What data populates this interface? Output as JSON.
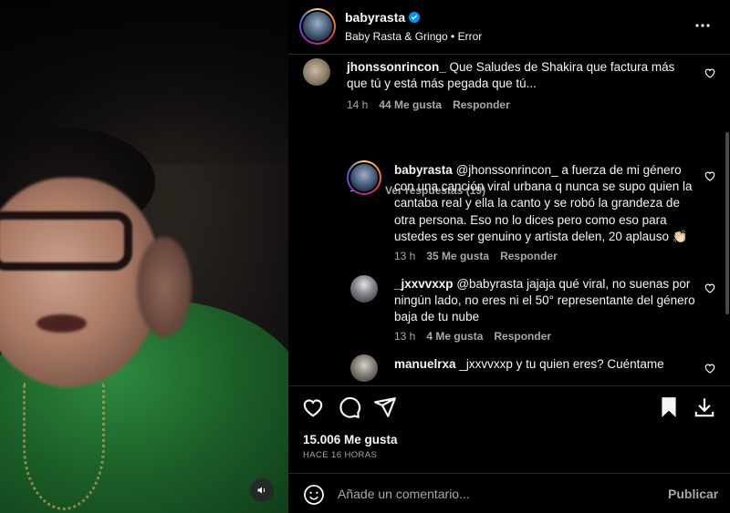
{
  "post": {
    "username": "babyrasta",
    "verified": true,
    "subtitle": "Baby Rasta & Gringo • Error",
    "more_icon": "more-horizontal-icon"
  },
  "comments": [
    {
      "username": "jhonssonrincon_",
      "text": "Que Saludes de Shakira que factura más que tú y está más pegada que tú...",
      "time": "14 h",
      "likes": "44 Me gusta",
      "reply": "Responder"
    }
  ],
  "view_replies": "Ver respuestas (19)",
  "replies": [
    {
      "username": "babyrasta",
      "text": "@jhonssonrincon_ a fuerza de mi género con una canción viral urbana q nunca se supo quien la cantaba real y ella la canto y se robó la grandeza de otra persona. Eso no lo dices pero como eso para ustedes es ser genuino y artista delen, 20 aplauso 👏🏻",
      "time": "13 h",
      "likes": "35 Me gusta",
      "reply": "Responder"
    },
    {
      "username": "_jxxvvxxp",
      "text": "@babyrasta jajaja qué viral, no suenas por ningún lado, no eres ni el 50° representante del género baja de tu nube",
      "time": "13 h",
      "likes": "4 Me gusta",
      "reply": "Responder"
    },
    {
      "username": "manuelrxa",
      "text": "_jxxvvxxp y tu quien eres? Cuéntame"
    }
  ],
  "actions": {
    "likes_count": "15.006 Me gusta",
    "time_ago": "HACE 16 HORAS"
  },
  "composer": {
    "placeholder": "Añade un comentario...",
    "publish_label": "Publicar"
  },
  "colors": {
    "background": "#000000",
    "text": "#f5f5f5",
    "muted": "#a8a8a8",
    "verified": "#0095f6",
    "divider": "#262626"
  }
}
